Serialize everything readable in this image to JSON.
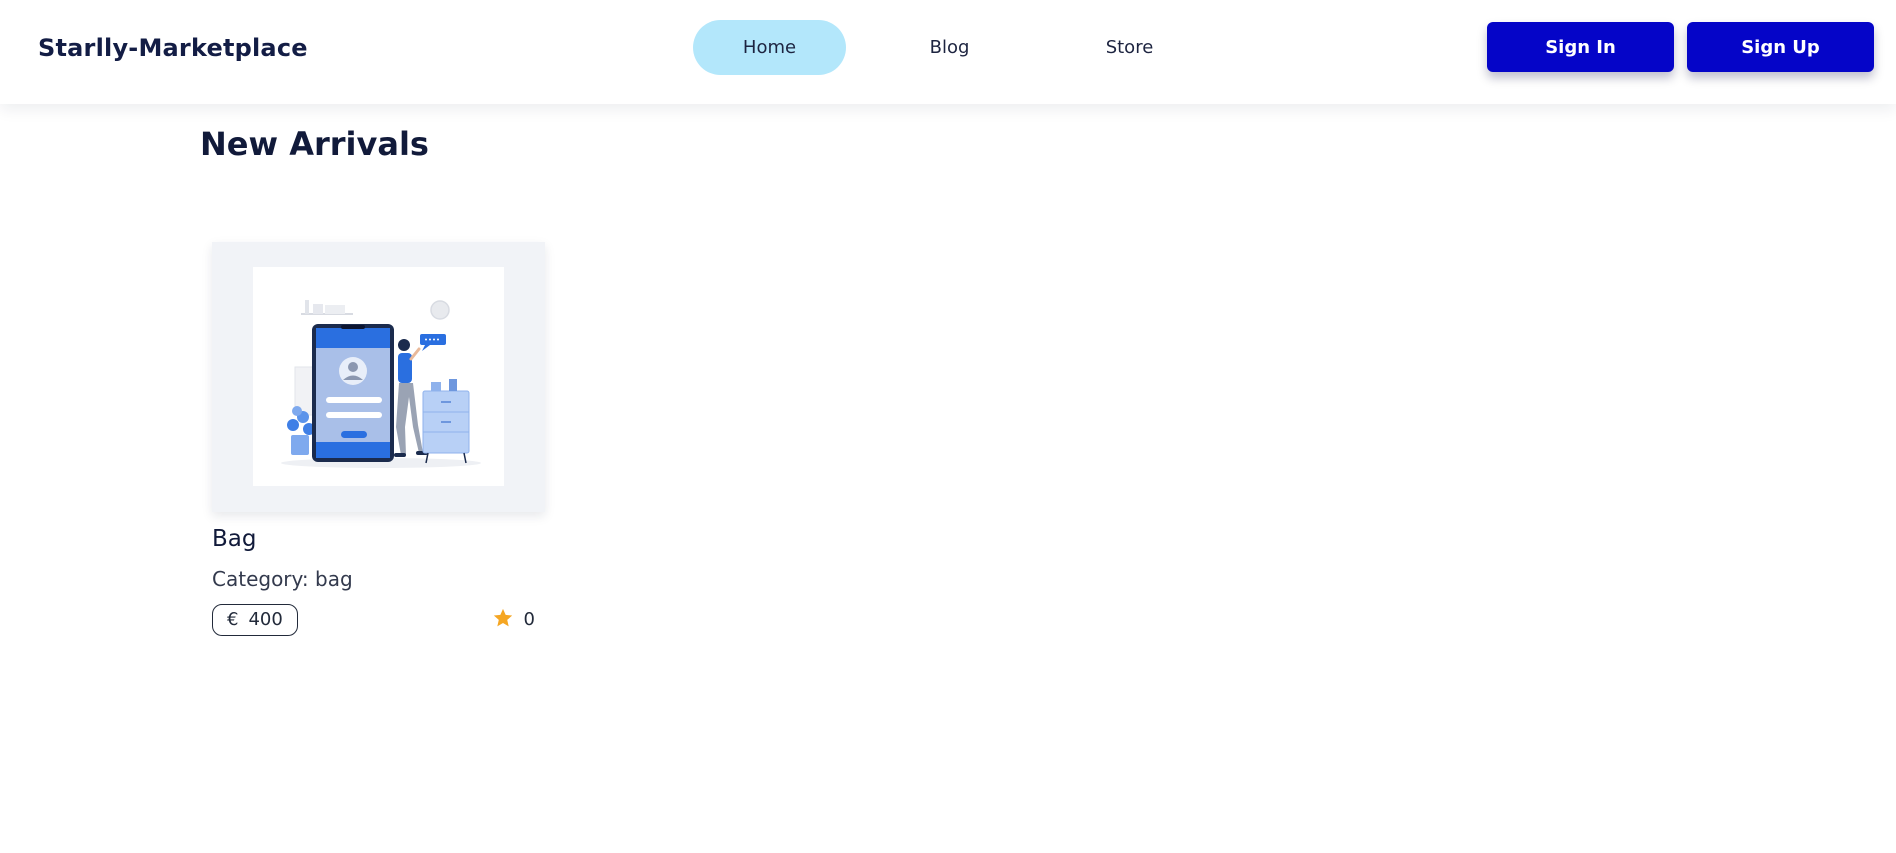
{
  "header": {
    "brand": "Starlly-Marketplace",
    "nav": [
      {
        "label": "Home",
        "active": true
      },
      {
        "label": "Blog",
        "active": false
      },
      {
        "label": "Store",
        "active": false
      }
    ],
    "sign_in_label": "Sign In",
    "sign_up_label": "Sign Up"
  },
  "main": {
    "section_title": "New Arrivals",
    "products": [
      {
        "title": "Bag",
        "category": "Category: bag",
        "currency": "€",
        "price": "400",
        "rating": "0"
      }
    ]
  },
  "colors": {
    "primary_button": "#0505c8",
    "active_nav": "#b3e7fb",
    "star": "#f5a623",
    "text_dark": "#111a3a"
  },
  "icons": {
    "rating": "star-icon"
  }
}
